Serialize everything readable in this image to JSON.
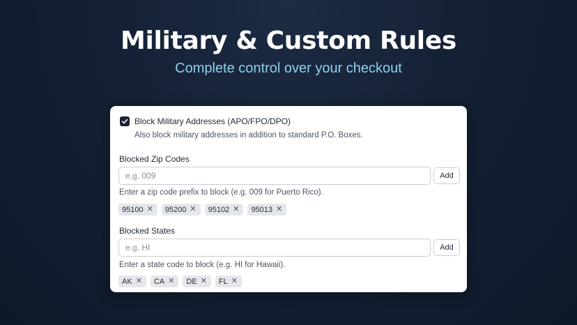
{
  "hero": {
    "title": "Military & Custom Rules",
    "subtitle": "Complete control over your checkout"
  },
  "military": {
    "checked": true,
    "label": "Block Military Addresses (APO/FPO/DPO)",
    "help": "Also block military addresses in addition to standard P.O. Boxes."
  },
  "zip_codes": {
    "label": "Blocked Zip Codes",
    "placeholder": "e.g. 009",
    "add_label": "Add",
    "help": "Enter a zip code prefix to block (e.g. 009 for Puerto Rico).",
    "tags": [
      "95100",
      "95200",
      "95102",
      "95013"
    ]
  },
  "states": {
    "label": "Blocked States",
    "placeholder": "e.g. HI",
    "add_label": "Add",
    "help": "Enter a state code to block (e.g. HI for Hawaii).",
    "tags": [
      "AK",
      "CA",
      "DE",
      "FL"
    ]
  },
  "icons": {
    "checkbox": "check-icon",
    "remove": "close-icon"
  },
  "colors": {
    "background": "#142034",
    "subtitle": "#8fd0ea",
    "checkbox": "#1a2233"
  }
}
